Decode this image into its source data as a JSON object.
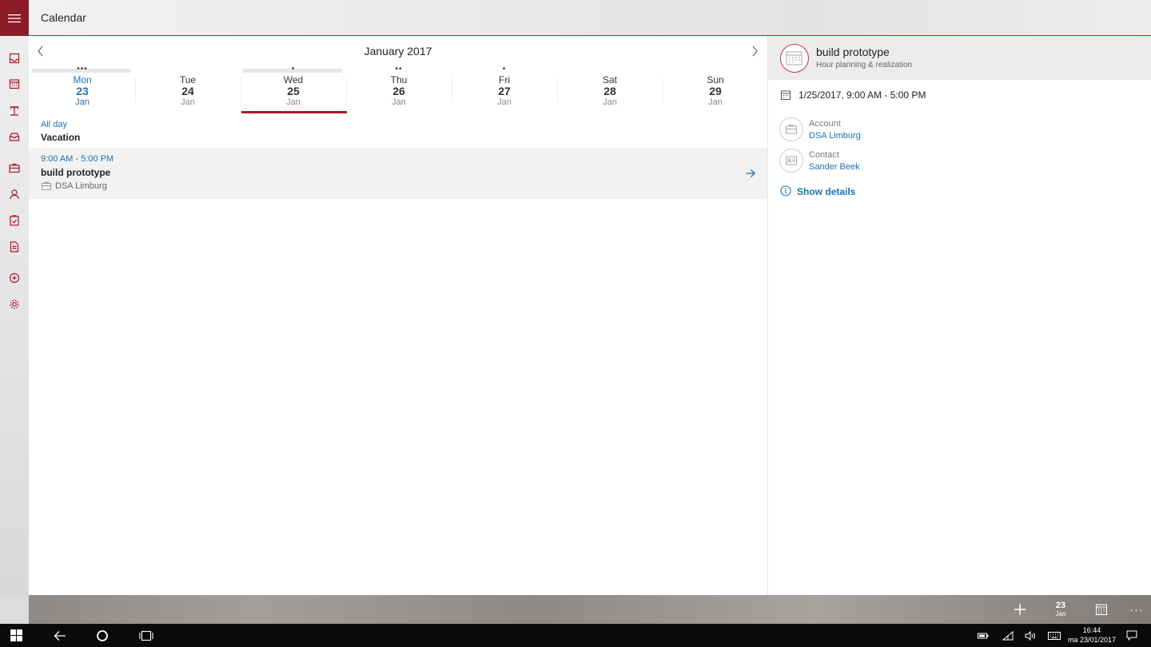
{
  "app": {
    "title": "Calendar"
  },
  "sidebar": {
    "icons": [
      "inbox-icon",
      "calendar-icon",
      "vacation-icon",
      "tray-icon",
      "briefcase-icon",
      "person-icon",
      "clipboard-icon",
      "document-icon",
      "report-icon",
      "settings-icon"
    ]
  },
  "calendar": {
    "month_label": "January 2017",
    "days": [
      {
        "dow": "Mon",
        "num": "23",
        "mon": "Jan",
        "dots": "•••",
        "today": true
      },
      {
        "dow": "Tue",
        "num": "24",
        "mon": "Jan",
        "dots": "",
        "today": false
      },
      {
        "dow": "Wed",
        "num": "25",
        "mon": "Jan",
        "dots": "•",
        "today": false,
        "selected": true
      },
      {
        "dow": "Thu",
        "num": "26",
        "mon": "Jan",
        "dots": "••",
        "today": false
      },
      {
        "dow": "Fri",
        "num": "27",
        "mon": "Jan",
        "dots": "•",
        "today": false
      },
      {
        "dow": "Sat",
        "num": "28",
        "mon": "Jan",
        "dots": "",
        "today": false
      },
      {
        "dow": "Sun",
        "num": "29",
        "mon": "Jan",
        "dots": "",
        "today": false
      }
    ],
    "all_day_label": "All day",
    "all_day_event": "Vacation",
    "event": {
      "time": "9:00 AM - 5:00 PM",
      "title": "build prototype",
      "account": "DSA Limburg"
    }
  },
  "detail": {
    "title": "build prototype",
    "subtitle": "Hour planning & realization",
    "datetime": "1/25/2017, 9:00 AM - 5:00 PM",
    "account_label": "Account",
    "account_value": "DSA Limburg",
    "contact_label": "Contact",
    "contact_value": "Sander Beek",
    "show_details": "Show details"
  },
  "appbar": {
    "today_num": "23",
    "today_mon": "Jan",
    "more": "···"
  },
  "taskbar": {
    "time": "16:44",
    "date": "ma 23/01/2017"
  },
  "colors": {
    "accent": "#8b1b25",
    "selected_underline": "#b2142b",
    "link": "#1a73b8"
  }
}
